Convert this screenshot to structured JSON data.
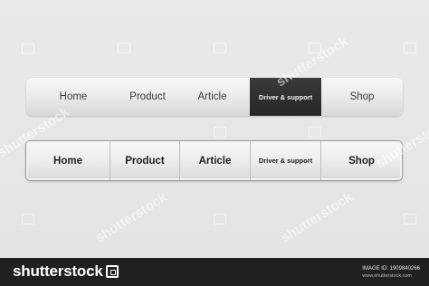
{
  "nav_bar_1": {
    "items": [
      {
        "label": "Home",
        "active": false
      },
      {
        "label": "Product",
        "active": false
      },
      {
        "label": "Article",
        "active": false
      },
      {
        "label": "Driver & support",
        "active": true
      },
      {
        "label": "Shop",
        "active": false
      }
    ],
    "colors": {
      "active_bg": "#2f2f2f",
      "active_text": "#f2f2f2",
      "text": "#3a3a3a"
    }
  },
  "nav_bar_2": {
    "items": [
      {
        "label": "Home"
      },
      {
        "label": "Product"
      },
      {
        "label": "Article"
      },
      {
        "label": "Driver & support"
      },
      {
        "label": "Shop"
      }
    ],
    "colors": {
      "border": "#9c9c9c",
      "divider": "#bdbdbd",
      "text": "#1e1e1e"
    }
  },
  "watermark": {
    "text": "shutterstock"
  },
  "footer": {
    "brand": "shutterstock",
    "image_id_label": "IMAGE ID: 1909840266",
    "site": "www.shutterstock.com"
  }
}
